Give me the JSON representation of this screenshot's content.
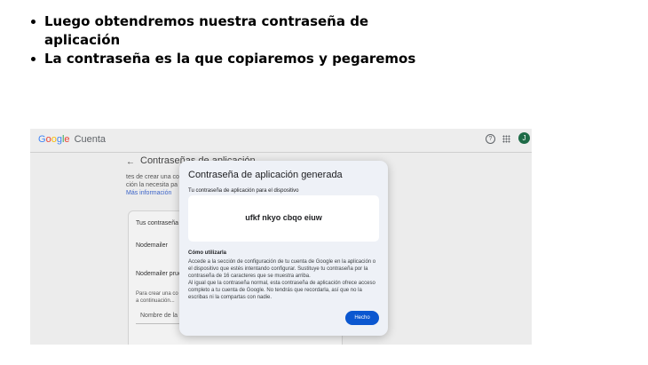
{
  "bullets": [
    "Luego obtendremos nuestra contraseña de aplicación",
    "La contraseña es la que copiaremos y pegaremos"
  ],
  "screenshot": {
    "brand": {
      "letters": [
        "G",
        "o",
        "o",
        "g",
        "l",
        "e"
      ],
      "product": "Cuenta"
    },
    "avatar_letter": "J",
    "icons": [
      "help-icon",
      "apps-icon",
      "back-arrow-icon"
    ],
    "page_title": "Contraseñas de aplicación",
    "intro_lines": [
      "tes de crear una co",
      "ción la necesita pa"
    ],
    "more_link": "Más información",
    "card": {
      "title": "Tus contraseña",
      "rows": [
        "Nodemailer",
        "Nodemailer prue"
      ],
      "create_text_lines": [
        "Para crear una co",
        "a continuación..."
      ],
      "name_placeholder": "Nombre de la"
    },
    "modal": {
      "title": "Contraseña de aplicación generada",
      "subtitle": "Tu contraseña de aplicación para el dispositivo",
      "password": "ufkf nkyo cbqo eiuw",
      "how_title": "Cómo utilizarla",
      "how_paragraphs": [
        "Accede a la sección de configuración de tu cuenta de Google en la aplicación o el dispositivo que estés intentando configurar. Sustituye tu contraseña por la contraseña de 16 caracteres que se muestra arriba.",
        "Al igual que la contraseña normal, esta contraseña de aplicación ofrece acceso completo a tu cuenta de Google. No tendrás que recordarla, así que no la escribas ni la compartas con nadie."
      ],
      "done_label": "Hecho"
    },
    "colors": {
      "overlay": "#ececec",
      "modal_bg": "#eef1f7",
      "button": "#0b57d0",
      "link": "#3c64c8",
      "avatar": "#1e6b47"
    }
  }
}
